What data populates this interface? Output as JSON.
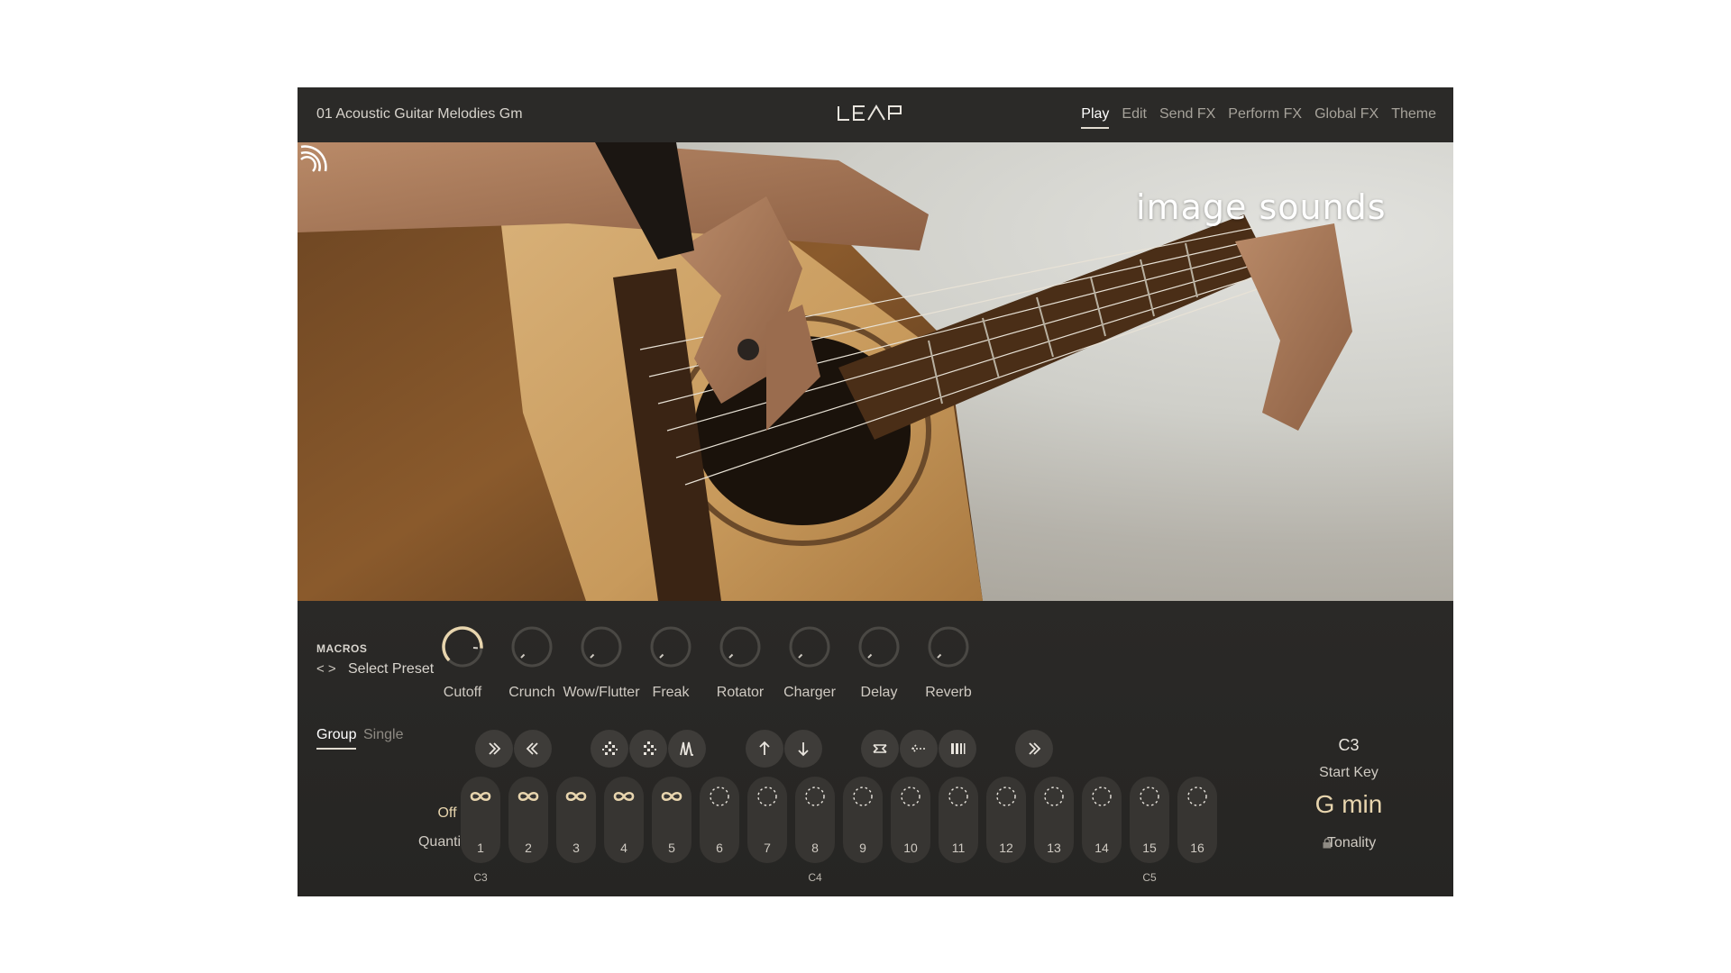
{
  "header": {
    "preset_name": "01 Acoustic Guitar Melodies Gm",
    "logo_text": "LEAP",
    "tabs": [
      {
        "label": "Play",
        "active": true
      },
      {
        "label": "Edit",
        "active": false
      },
      {
        "label": "Send FX",
        "active": false
      },
      {
        "label": "Perform FX",
        "active": false
      },
      {
        "label": "Global FX",
        "active": false
      },
      {
        "label": "Theme",
        "active": false
      }
    ]
  },
  "hero": {
    "brand_text": "image sounds",
    "brand_icon": "wifi-waves-icon"
  },
  "macros": {
    "title": "MACROS",
    "nav_arrows": "< >",
    "select_label": "Select Preset",
    "knobs": [
      {
        "label": "Cutoff",
        "value": 0.85
      },
      {
        "label": "Crunch",
        "value": 0.0
      },
      {
        "label": "Wow/Flutter",
        "value": 0.0
      },
      {
        "label": "Freak",
        "value": 0.0
      },
      {
        "label": "Rotator",
        "value": 0.0
      },
      {
        "label": "Charger",
        "value": 0.0
      },
      {
        "label": "Delay",
        "value": 0.0
      },
      {
        "label": "Reverb",
        "value": 0.0
      }
    ]
  },
  "mode": {
    "group": "Group",
    "single": "Single"
  },
  "quantize": {
    "value": "Off",
    "label": "Quantize"
  },
  "controls": [
    {
      "name": "fast-forward-icon"
    },
    {
      "name": "rewind-icon"
    },
    {
      "name": "scatter-icon"
    },
    {
      "name": "scatter-alt-icon"
    },
    {
      "name": "envelope-icon"
    },
    {
      "name": "arrow-up-icon"
    },
    {
      "name": "arrow-down-icon"
    },
    {
      "name": "loop-swap-icon"
    },
    {
      "name": "reverse-icon"
    },
    {
      "name": "stutter-icon"
    },
    {
      "name": "next-icon"
    }
  ],
  "slots": [
    {
      "num": "1",
      "state": "loop"
    },
    {
      "num": "2",
      "state": "loop"
    },
    {
      "num": "3",
      "state": "loop"
    },
    {
      "num": "4",
      "state": "loop"
    },
    {
      "num": "5",
      "state": "loop"
    },
    {
      "num": "6",
      "state": "empty"
    },
    {
      "num": "7",
      "state": "empty"
    },
    {
      "num": "8",
      "state": "empty"
    },
    {
      "num": "9",
      "state": "empty"
    },
    {
      "num": "10",
      "state": "empty"
    },
    {
      "num": "11",
      "state": "empty"
    },
    {
      "num": "12",
      "state": "empty"
    },
    {
      "num": "13",
      "state": "empty"
    },
    {
      "num": "14",
      "state": "empty"
    },
    {
      "num": "15",
      "state": "empty"
    },
    {
      "num": "16",
      "state": "empty"
    }
  ],
  "octave_labels": [
    "C3",
    "C4",
    "C5"
  ],
  "start_key": {
    "value": "C3",
    "label": "Start Key"
  },
  "tonality": {
    "value": "G  min",
    "label": "Tonality",
    "lock_icon": "lock-icon"
  },
  "colors": {
    "accent": "#e8d5ae",
    "panel": "#262523",
    "header": "#2b2a28"
  }
}
